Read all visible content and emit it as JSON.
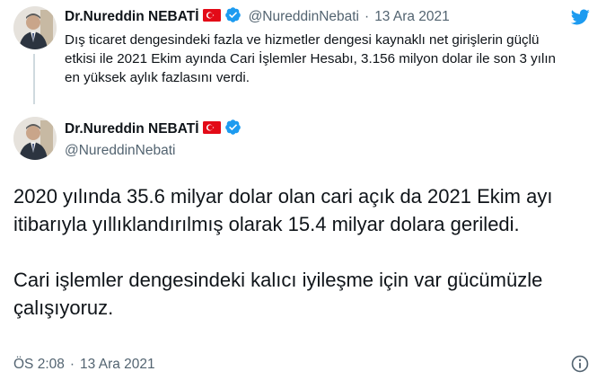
{
  "parent_tweet": {
    "display_name": "Dr.Nureddin NEBATİ",
    "handle": "@NureddinNebati",
    "separator": "·",
    "date": "13 Ara 2021",
    "text": "Dış ticaret dengesindeki fazla ve hizmetler dengesi kaynaklı net girişlerin güçlü etkisi ile 2021 Ekim ayında Cari İşlemler Hesabı, 3.156 milyon dolar ile son 3 yılın en yüksek aylık fazlasını verdi."
  },
  "main_tweet": {
    "display_name": "Dr.Nureddin NEBATİ",
    "handle": "@NureddinNebati",
    "paragraphs": [
      "2020 yılında 35.6 milyar dolar olan cari açık da 2021 Ekim ayı itibarıyla yıllıklandırılmış olarak 15.4 milyar dolara geriledi.",
      "Cari işlemler dengesindeki kalıcı iyileşme için var gücümüzle çalışıyoruz."
    ],
    "time": "ÖS 2:08",
    "separator": "·",
    "date": "13 Ara 2021"
  },
  "colors": {
    "twitter_blue": "#1d9bf0",
    "verified_blue": "#1d9bf0",
    "muted_text": "#536471",
    "thread_line": "#cfd9de"
  },
  "icons": {
    "brand": "twitter-bird-icon",
    "verified": "verified-badge-icon",
    "flag": "turkey-flag-icon",
    "info": "info-icon"
  }
}
